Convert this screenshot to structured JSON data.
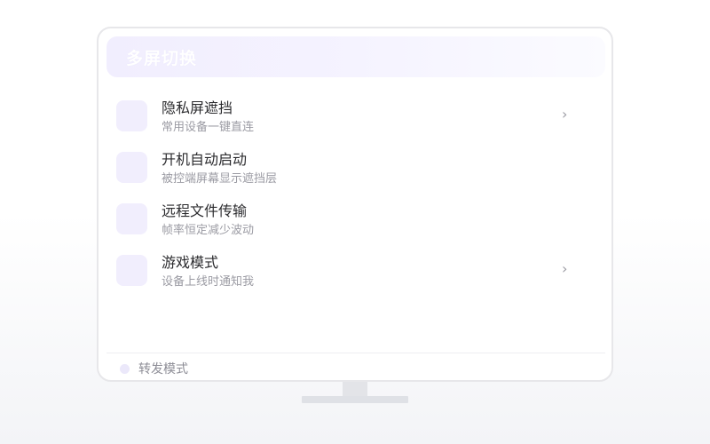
{
  "window": {
    "title": "多屏切换"
  },
  "list": {
    "items": [
      {
        "title": "隐私屏遮挡",
        "subtitle": "常用设备一键直连",
        "has_chevron": true,
        "chevron": "›"
      },
      {
        "title": "开机自动启动",
        "subtitle": "被控端屏幕显示遮挡层",
        "has_chevron": false,
        "chevron": ""
      },
      {
        "title": "远程文件传输",
        "subtitle": "帧率恒定减少波动",
        "has_chevron": false,
        "chevron": ""
      },
      {
        "title": "游戏模式",
        "subtitle": "设备上线时通知我",
        "has_chevron": true,
        "chevron": "›"
      }
    ]
  },
  "footer": {
    "label": "转发模式"
  },
  "colors": {
    "title_bar_start": "#f1eefe",
    "title_bar_end": "#fbfbff",
    "icon_tile": "#f1eefd",
    "title_text": "#2b2b2e",
    "subtitle_text": "#9b9ba3",
    "monitor_border": "#e7e7ea",
    "stand": "#dfe1e6"
  }
}
